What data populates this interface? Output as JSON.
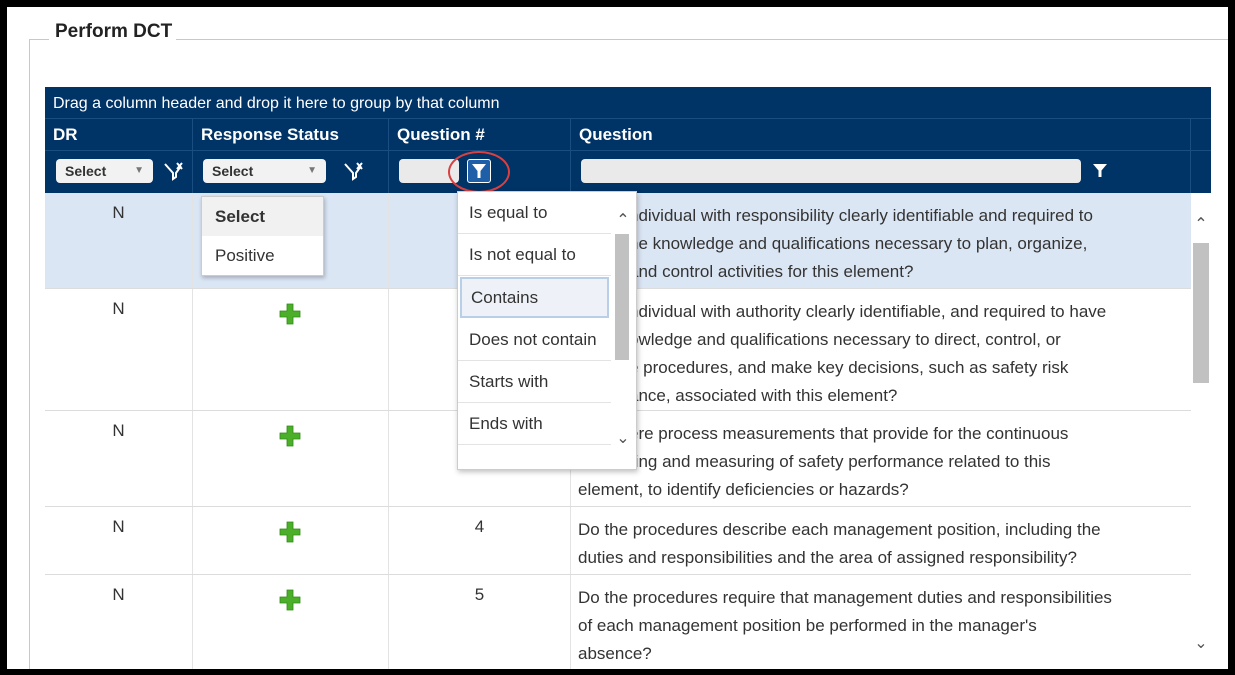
{
  "panel": {
    "title": "Perform DCT"
  },
  "grid": {
    "group_hint": "Drag a column header and drop it here to group by that column",
    "columns": [
      "DR",
      "Response Status",
      "Question #",
      "Question"
    ],
    "filters": {
      "dr_select": "Select",
      "status_select": "Select"
    },
    "rows": [
      {
        "dr": "N",
        "status": "",
        "number": "",
        "question": "Is an individual with responsibility clearly identifiable and required to have the knowledge and qualifications necessary to plan, organize, direct and control activities for this element?"
      },
      {
        "dr": "N",
        "status": "plus",
        "number": "",
        "question": "Is an individual with authority clearly identifiable, and required to have the knowledge and qualifications necessary to direct, control, or change procedures, and make key decisions, such as safety risk acceptance, associated with this element?"
      },
      {
        "dr": "N",
        "status": "plus",
        "number": "",
        "question": "Are there process measurements that provide for the continuous monitoring and measuring of safety performance related to this element, to identify deficiencies or hazards?"
      },
      {
        "dr": "N",
        "status": "plus",
        "number": "4",
        "question": "Do the procedures describe each management position, including the duties and responsibilities and the area of assigned responsibility?"
      },
      {
        "dr": "N",
        "status": "plus",
        "number": "5",
        "question": "Do the procedures require that management duties and responsibilities of each management position be performed in the manager's absence?"
      }
    ],
    "visible_questions": [
      [
        "ndividual with responsibility clearly identifiable and required to",
        "ne knowledge and qualifications necessary to plan, organize,",
        "and control activities for this element?"
      ],
      [
        "ndividual with authority clearly identifiable, and required to have",
        "owledge and qualifications necessary to direct, control, or",
        "e procedures, and make key decisions, such as safety risk",
        "ance, associated with this element?"
      ],
      [
        "ere process measurements that provide for the continuous",
        "ring and measuring of safety performance related to this",
        "element, to identify deficiencies or hazards?"
      ],
      [
        "Do the procedures describe each management position, including the",
        "duties and responsibilities and the area of assigned responsibility?"
      ],
      [
        "Do the procedures require that management duties and responsibilities",
        "of each management position be performed in the manager's",
        "absence?"
      ]
    ]
  },
  "status_dropdown": {
    "options": [
      "Select",
      "Positive"
    ]
  },
  "operator_dropdown": {
    "options": [
      "Is equal to",
      "Is not equal to",
      "Contains",
      "Does not contain",
      "Starts with",
      "Ends with"
    ],
    "selected": "Contains"
  },
  "colors": {
    "header_bg": "#003366",
    "selected_row": "#dbe6f5",
    "plus_icon": "#4caf2a",
    "highlight_circle": "#d94040"
  }
}
